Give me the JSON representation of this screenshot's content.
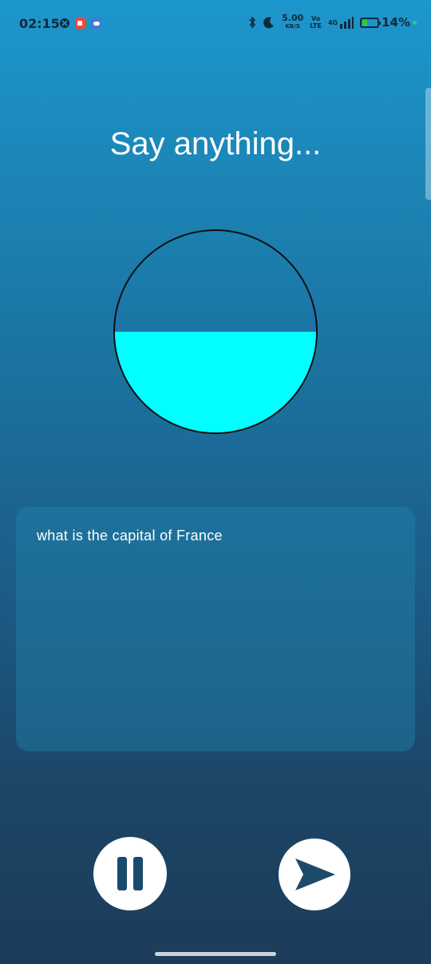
{
  "status_bar": {
    "time": "02:15",
    "speed_value": "5.00",
    "speed_unit": "KB/S",
    "volte_top": "Vo",
    "volte_bottom": "LTE",
    "network": "4G",
    "battery_percent": "14%",
    "icons": [
      "xbox-icon",
      "screen-record-icon",
      "cloud-icon",
      "bluetooth-icon",
      "moon-icon",
      "signal-icon",
      "battery-charging-icon"
    ]
  },
  "main": {
    "prompt": "Say anything...",
    "level_fraction": 0.5,
    "level_color": "#00ffff",
    "transcript": "what is the capital of France"
  },
  "controls": {
    "pause_icon": "pause-icon",
    "send_icon": "send-icon"
  }
}
